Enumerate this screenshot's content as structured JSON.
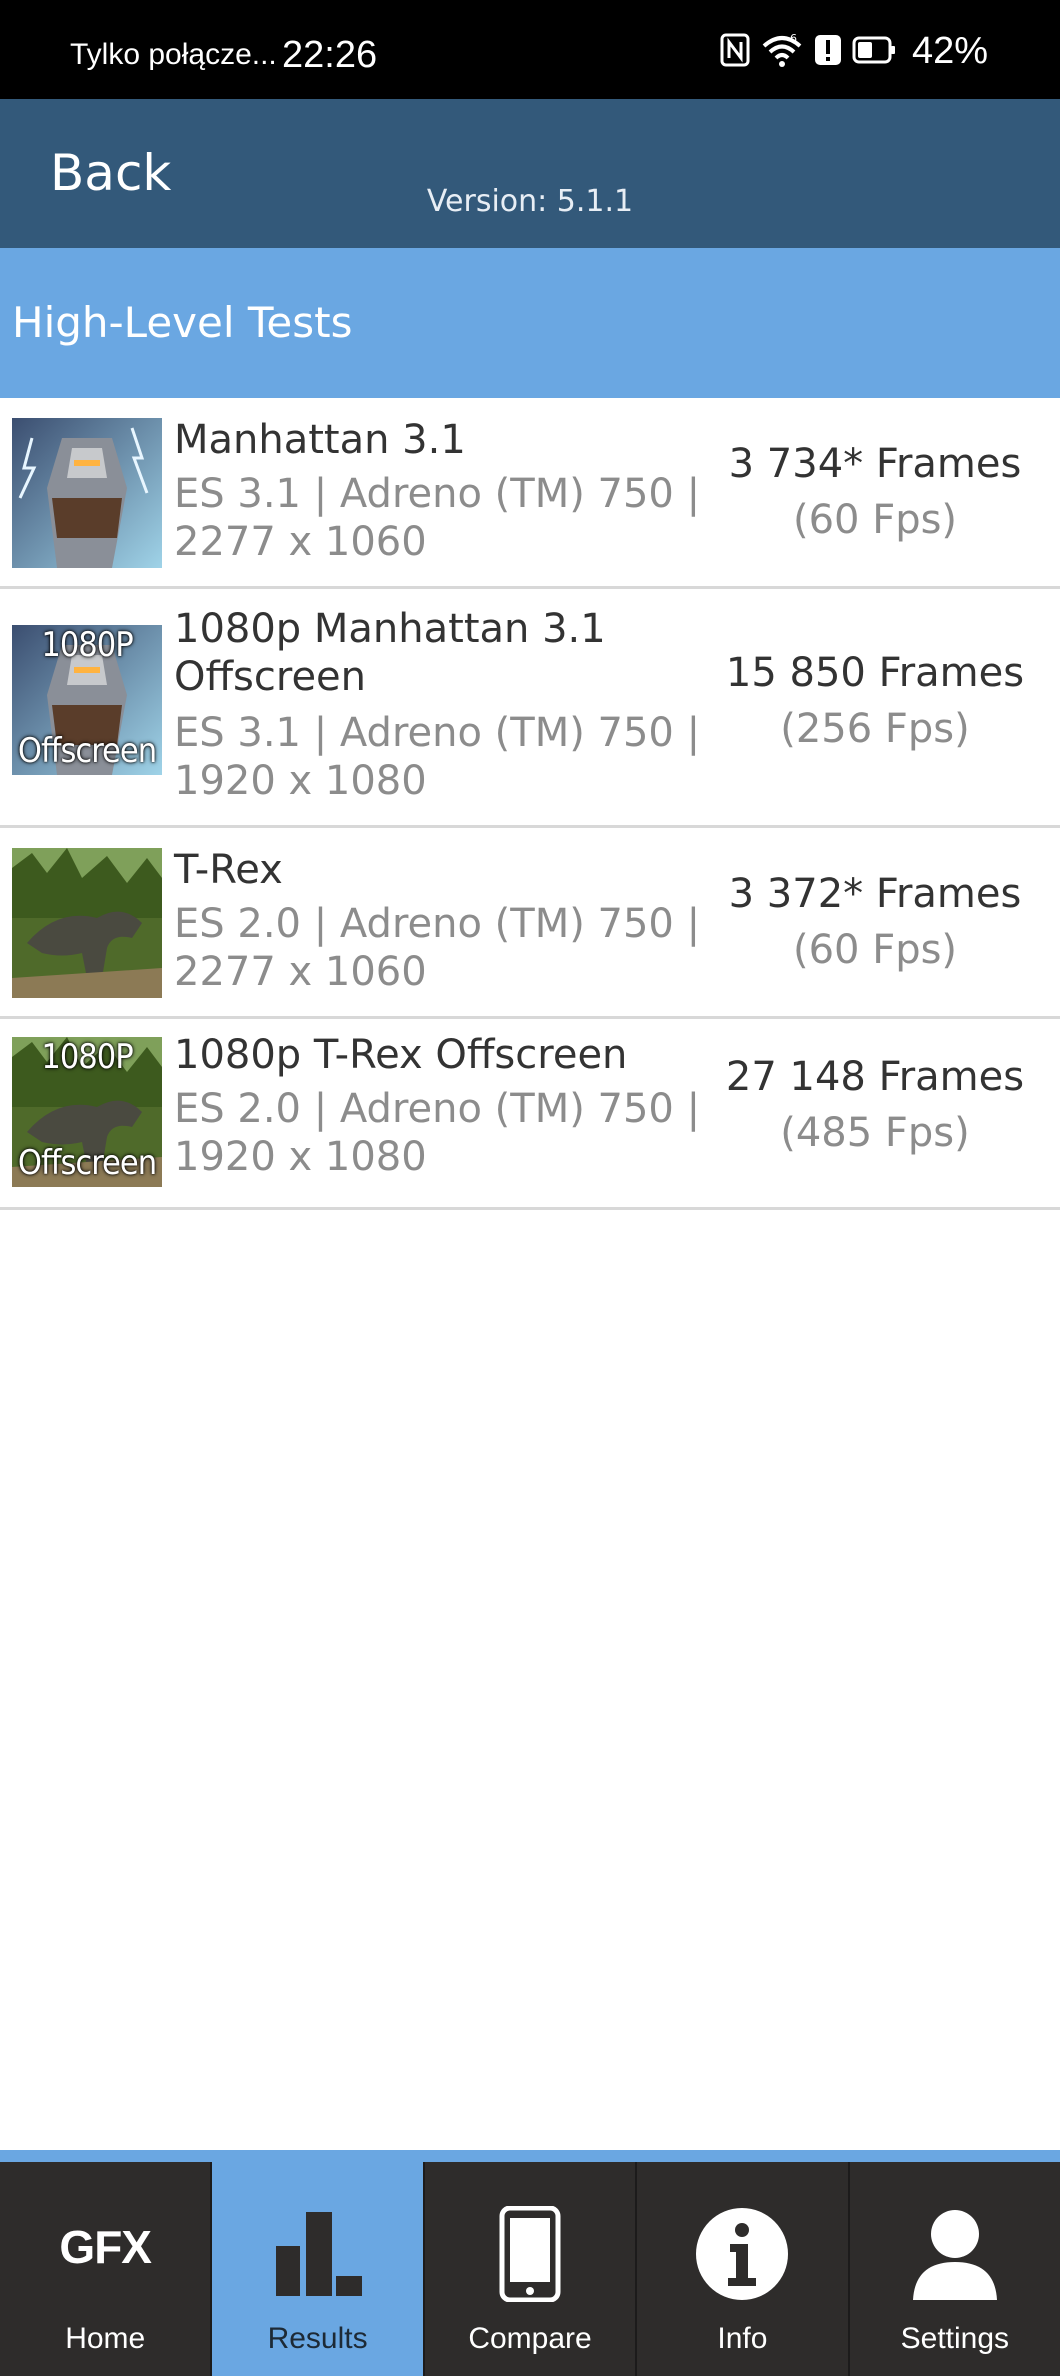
{
  "status_bar": {
    "carrier": "Tylko połącze...",
    "time": "22:26",
    "battery": "42%",
    "icons": [
      "nfc-icon",
      "wifi-6-icon",
      "alert-icon",
      "battery-icon"
    ]
  },
  "header": {
    "back_label": "Back",
    "version": "Version: 5.1.1"
  },
  "section": {
    "title": "High-Level Tests"
  },
  "tests": [
    {
      "name": "Manhattan 3.1",
      "desc_line1": "ES 3.1 | Adreno (TM) 750 |",
      "desc_line2": "2277 x 1060",
      "frames": "3 734* Frames",
      "fps": "(60 Fps)",
      "thumb": "manhattan-thumbnail"
    },
    {
      "name_line1": "1080p Manhattan 3.1",
      "name_line2": "Offscreen",
      "desc_line1": "ES 3.1 | Adreno (TM) 750 |",
      "desc_line2": "1920 x 1080",
      "frames": "15 850 Frames",
      "fps": "(256 Fps)",
      "thumb_top": "1080P",
      "thumb_bottom": "Offscreen"
    },
    {
      "name": "T-Rex",
      "desc_line1": "ES 2.0 | Adreno (TM) 750 |",
      "desc_line2": "2277 x 1060",
      "frames": "3 372* Frames",
      "fps": "(60 Fps)",
      "thumb": "trex-thumbnail"
    },
    {
      "name": "1080p T-Rex Offscreen",
      "desc_line1": "ES 2.0 | Adreno (TM) 750 |",
      "desc_line2": "1920 x 1080",
      "frames": "27 148 Frames",
      "fps": "(485 Fps)",
      "thumb_top": "1080P",
      "thumb_bottom": "Offscreen"
    }
  ],
  "nav": {
    "logo": "GFX",
    "items": [
      {
        "label": "Home",
        "icon": "gfx-logo-icon"
      },
      {
        "label": "Results",
        "icon": "bar-chart-icon",
        "active": true
      },
      {
        "label": "Compare",
        "icon": "phone-icon"
      },
      {
        "label": "Info",
        "icon": "info-icon"
      },
      {
        "label": "Settings",
        "icon": "user-icon"
      }
    ]
  },
  "colors": {
    "header_bg": "#33597a",
    "section_bg": "#6aa7e2",
    "nav_bg": "#2e2c2b",
    "nav_active_bg": "#6aa7e2"
  }
}
